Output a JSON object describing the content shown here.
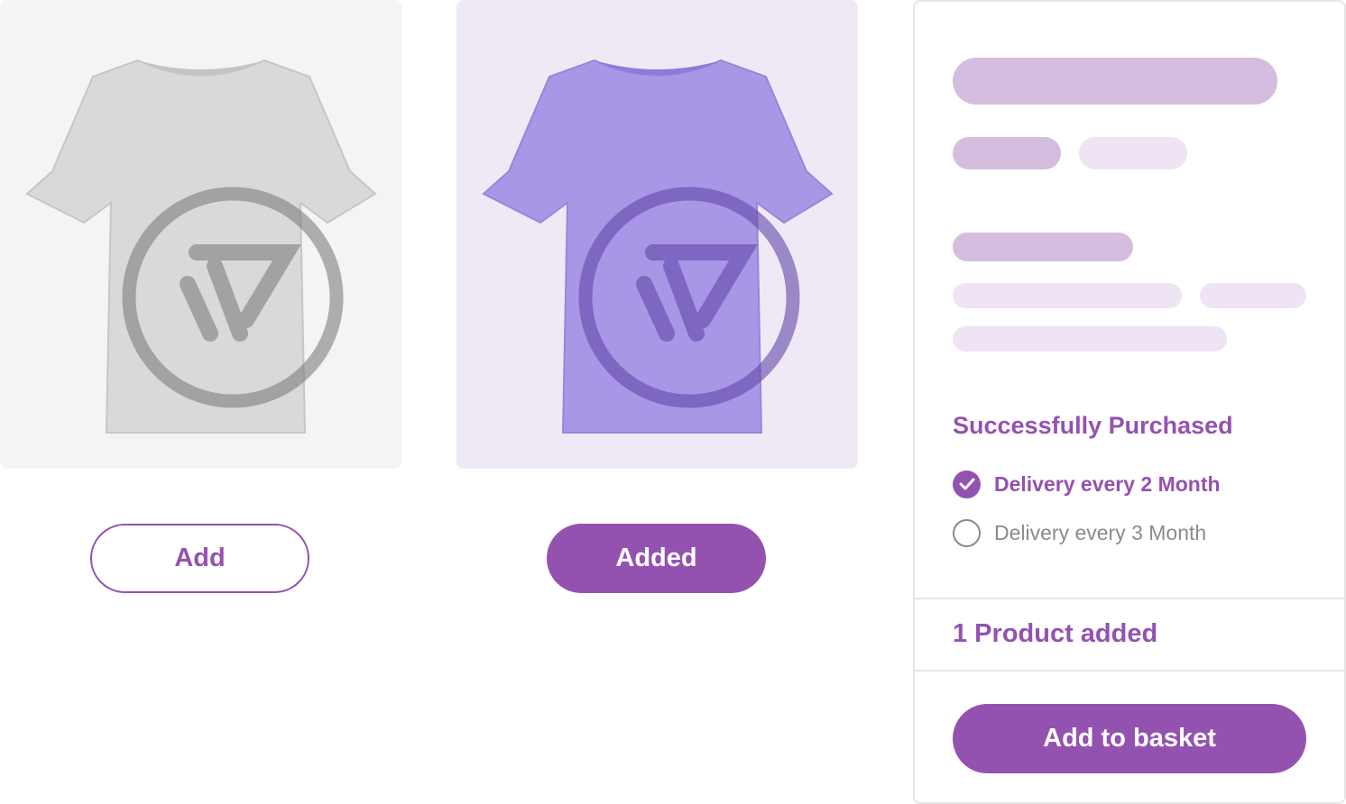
{
  "products": [
    {
      "color": "#d9d9d9",
      "logo_color": "#7d7d7d"
    },
    {
      "color": "#a896e6",
      "logo_color": "#6048a8"
    }
  ],
  "buttons": {
    "add_label": "Add",
    "added_label": "Added"
  },
  "panel": {
    "purchase_title": "Successfully Purchased",
    "options": [
      {
        "label": "Delivery every 2 Month",
        "selected": true
      },
      {
        "label": "Delivery every 3 Month",
        "selected": false
      }
    ],
    "product_count_text": "1 Product added",
    "basket_button_label": "Add to basket"
  },
  "colors": {
    "accent": "#9452b0",
    "skeleton_dark": "#d4bddf",
    "skeleton_light": "#efe4f3",
    "card_gray_bg": "#f4f4f4",
    "card_purple_bg": "#efe9f6"
  }
}
